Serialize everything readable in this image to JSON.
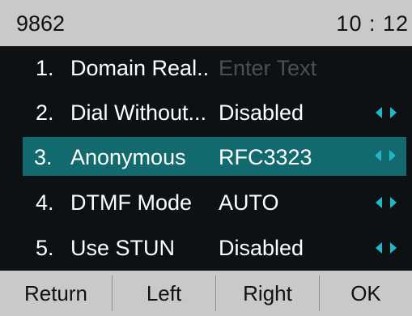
{
  "status_bar": {
    "extension": "9862",
    "time": "10 : 12"
  },
  "menu": {
    "items": [
      {
        "number": "1.",
        "label": "Domain Real..",
        "value": "Enter Text",
        "value_is_placeholder": true,
        "has_arrows": false
      },
      {
        "number": "2.",
        "label": "Dial Without...",
        "value": "Disabled",
        "value_is_placeholder": false,
        "has_arrows": true
      },
      {
        "number": "3.",
        "label": "Anonymous",
        "value": "RFC3323",
        "value_is_placeholder": false,
        "has_arrows": true,
        "selected": true
      },
      {
        "number": "4.",
        "label": "DTMF Mode",
        "value": "AUTO",
        "value_is_placeholder": false,
        "has_arrows": true
      },
      {
        "number": "5.",
        "label": "Use STUN",
        "value": "Disabled",
        "value_is_placeholder": false,
        "has_arrows": true
      }
    ]
  },
  "softkeys": {
    "return_label": "Return",
    "left_label": "Left",
    "right_label": "Right",
    "ok_label": "OK"
  },
  "colors": {
    "status_bar_bg": "#c9c9c9",
    "screen_bg": "#0d1114",
    "selection_bg": "#136a6e",
    "arrow_accent": "#1fb8c9",
    "placeholder_text": "#4a4f53"
  },
  "icons": {
    "arrow_pair": "left-right-arrows-icon"
  }
}
